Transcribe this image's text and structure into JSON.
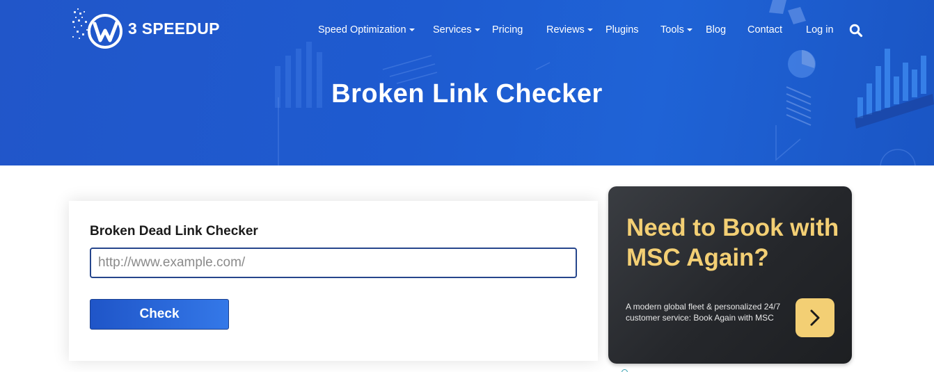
{
  "brand": {
    "name": "3 SPEEDUP"
  },
  "nav": {
    "items": [
      {
        "label": "Speed Optimization",
        "dropdown": true
      },
      {
        "label": "Services",
        "dropdown": true
      },
      {
        "label": "Pricing",
        "dropdown": false
      },
      {
        "label": "Reviews",
        "dropdown": true
      },
      {
        "label": "Plugins",
        "dropdown": false
      },
      {
        "label": "Tools",
        "dropdown": true
      },
      {
        "label": "Blog",
        "dropdown": false
      },
      {
        "label": "Contact",
        "dropdown": false
      },
      {
        "label": "Log in",
        "dropdown": false
      }
    ],
    "search_icon": "search-icon"
  },
  "hero": {
    "title": "Broken Link Checker"
  },
  "tool": {
    "heading": "Broken Dead Link Checker",
    "url_placeholder": "http://www.example.com/",
    "url_value": "",
    "check_label": "Check"
  },
  "ad": {
    "headline": "Need to Book with MSC Again?",
    "body": "A modern global fleet & personalized 24/7 customer service: Book Again with MSC",
    "button_icon": "chevron-right-icon"
  },
  "colors": {
    "hero_blue": "#1e5bd0",
    "button_blue": "#2a66d8",
    "input_border": "#26468c",
    "ad_gold": "#f3cf74",
    "ad_dark": "#25272b"
  }
}
